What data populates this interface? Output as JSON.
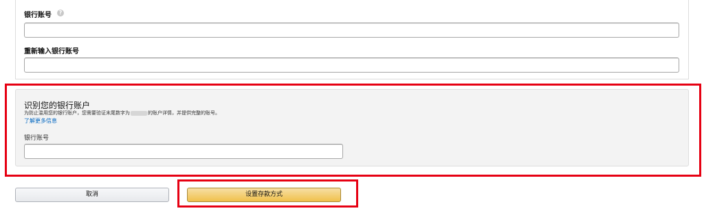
{
  "account_form": {
    "account_number_label": "银行账号",
    "help_icon_glyph": "?",
    "reenter_label": "重新输入银行账号",
    "account_number_value": "",
    "reenter_value": ""
  },
  "verification": {
    "title": "识别您的银行账户",
    "description_before": "为防止滥用您的银行账户，您需要验证末尾数字为",
    "description_after": "的账户详情，并提供完整的账号。",
    "learn_more": "了解更多信息",
    "account_number_label": "银行账号",
    "account_number_value": ""
  },
  "actions": {
    "cancel_label": "取消",
    "submit_label": "设置存款方式"
  },
  "colors": {
    "highlight": "#e60012",
    "link": "#0066c0",
    "primary_button": "#f0c14b",
    "panel_background": "#f3f3f3"
  },
  "icons": [
    "help-icon"
  ]
}
